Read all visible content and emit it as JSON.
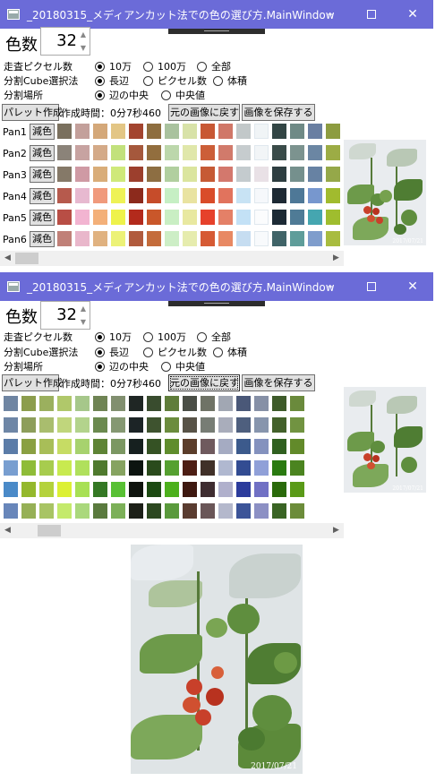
{
  "windows": [
    {
      "title": "_20180315_メディアンカット法での色の選び方.MainWindow",
      "colors_label": "色数",
      "colors_value": "32",
      "opt1": {
        "label": "走査ピクセル数",
        "choices": [
          "10万",
          "100万",
          "全部"
        ],
        "selected": 0
      },
      "opt2": {
        "label": "分割Cube選択法",
        "choices": [
          "長辺",
          "ピクセル数",
          "体積"
        ],
        "selected": 0
      },
      "opt3": {
        "label": "分割場所",
        "choices": [
          "辺の中央",
          "中央値"
        ],
        "selected": 0
      },
      "make_button": "パレット作成",
      "time_text": "作成時間：0分7秒460",
      "restore_button": "元の画像に戻す",
      "save_button": "画像を保存する",
      "reduce_label": "減色",
      "rows": [
        {
          "name": "Pan1",
          "colors": [
            "#7a705e",
            "#c3a09b",
            "#d4a879",
            "#e3c685",
            "#a3442f",
            "#8e6e3f",
            "#a9c29e",
            "#d8e2a8",
            "#c85834",
            "#d07768",
            "#c2c8c9",
            "#f0f4f6",
            "#324544",
            "#6f8a86",
            "#6a7fa2",
            "#8d9c40"
          ]
        },
        {
          "name": "Pan2",
          "colors": [
            "#8b8379",
            "#c7a3a1",
            "#d4aa88",
            "#c2e17c",
            "#a5583c",
            "#926e3e",
            "#bcd7ab",
            "#e0e7aa",
            "#cc5e38",
            "#d17a6b",
            "#c6ccce",
            "#f2f5f7",
            "#3a4b49",
            "#7c938f",
            "#6b86a3",
            "#9cac45"
          ]
        },
        {
          "name": "Pan3",
          "colors": [
            "#857968",
            "#cf9aa4",
            "#d9ad79",
            "#cfe97a",
            "#9c3f2d",
            "#8d6e42",
            "#b1cf9f",
            "#dbe59e",
            "#c65a35",
            "#d3786d",
            "#c4cbce",
            "#e9e1e6",
            "#2e3e41",
            "#75908d",
            "#6782a3",
            "#95a849"
          ]
        },
        {
          "name": "Pan4",
          "colors": [
            "#b65a4d",
            "#e7b9d0",
            "#f09a7c",
            "#eef256",
            "#8c2a1c",
            "#c64c2a",
            "#c6efc4",
            "#e9e3a1",
            "#d94c2a",
            "#e1735d",
            "#c8e3f4",
            "#f6f8fb",
            "#1e2a34",
            "#4e7897",
            "#7797ce",
            "#a1bb2e"
          ]
        },
        {
          "name": "Pan5",
          "colors": [
            "#b84e45",
            "#f2b4d1",
            "#f3b079",
            "#eef24b",
            "#b32a1c",
            "#c9572a",
            "#c9eec3",
            "#e8e8a0",
            "#e6412b",
            "#e48067",
            "#c3e1f6",
            "#fbfcfd",
            "#1c2a35",
            "#4f7b96",
            "#45a6b0",
            "#9fbd2e"
          ]
        },
        {
          "name": "Pan6",
          "colors": [
            "#c08078",
            "#e9b7cb",
            "#e0b280",
            "#ecf277",
            "#b15b3d",
            "#c46c3b",
            "#cdeec6",
            "#e6ecae",
            "#d65a34",
            "#e88963",
            "#c6ddf1",
            "#f8fafc",
            "#406468",
            "#5f9d9a",
            "#7f9dcc",
            "#a8bc3f"
          ]
        }
      ],
      "photo_date": "2017/07/21"
    },
    {
      "title": "_20180315_メディアンカット法での色の選び方.MainWindow",
      "colors_label": "色数",
      "colors_value": "32",
      "opt1": {
        "label": "走査ピクセル数",
        "choices": [
          "10万",
          "100万",
          "全部"
        ],
        "selected": 0
      },
      "opt2": {
        "label": "分割Cube選択法",
        "choices": [
          "長辺",
          "ピクセル数",
          "体積"
        ],
        "selected": 0
      },
      "opt3": {
        "label": "分割場所",
        "choices": [
          "辺の中央",
          "中央値"
        ],
        "selected": 0
      },
      "make_button": "パレット作成",
      "time_text": "作成時間：0分7秒460",
      "restore_button": "元の画像に戻す",
      "save_button": "画像を保存する",
      "rows": [
        {
          "colors": [
            "#6f85a2",
            "#8c9d4d",
            "#9bb05e",
            "#b0c86a",
            "#a6c78a",
            "#6f8454",
            "#818f6f",
            "#1f2624",
            "#394c2e",
            "#5f7d3a",
            "#4a4e46",
            "#6f7366",
            "#a1a7b3",
            "#4a5878",
            "#8690a6",
            "#3e5b2a",
            "#6a8a3c"
          ]
        },
        {
          "colors": [
            "#6e86a6",
            "#8d9e5b",
            "#a9bd6e",
            "#c0d67c",
            "#b3d38c",
            "#6b8a4f",
            "#859872",
            "#1c2426",
            "#3e532f",
            "#6b8c3d",
            "#585347",
            "#777d75",
            "#a9adbb",
            "#4e5f7e",
            "#8795ad",
            "#43612b",
            "#719341"
          ]
        },
        {
          "colors": [
            "#5b7ca8",
            "#8aa042",
            "#a8be58",
            "#c6dc64",
            "#a7d26e",
            "#5e8435",
            "#7b9762",
            "#16201f",
            "#355224",
            "#5f8d2c",
            "#5b3d2a",
            "#6f5a5e",
            "#a5abc2",
            "#3c5a8c",
            "#8492be",
            "#306020",
            "#628a2a"
          ]
        },
        {
          "colors": [
            "#789ed0",
            "#8fbc38",
            "#a7cc4e",
            "#c8ea50",
            "#b0e05c",
            "#4f7a2e",
            "#86a360",
            "#0c1410",
            "#2a4a1c",
            "#55a030",
            "#4d1e14",
            "#403028",
            "#b0b8d0",
            "#324c92",
            "#90a0d8",
            "#2a7a10",
            "#4b8420"
          ]
        },
        {
          "colors": [
            "#4a8ac8",
            "#94b82c",
            "#b4d23c",
            "#dcf034",
            "#a8e054",
            "#347824",
            "#58c034",
            "#0f140e",
            "#1c4a12",
            "#4cb01c",
            "#3e1810",
            "#3e2c30",
            "#b0b0cc",
            "#2c3c9c",
            "#7070c4",
            "#2a6a0a",
            "#5a9a18"
          ]
        },
        {
          "colors": [
            "#6886ba",
            "#96b056",
            "#a8c464",
            "#c4ea6c",
            "#aad87c",
            "#5a7a3e",
            "#7cb058",
            "#1c2018",
            "#2c4820",
            "#5a9a3c",
            "#5a3c30",
            "#6a5658",
            "#b4b8cc",
            "#3c5498",
            "#8c90c4",
            "#3a6424",
            "#6c8c3a"
          ]
        }
      ],
      "photo_date": "2017/07/21",
      "big_photo_date": "2017/07/21"
    }
  ],
  "icons": {
    "minimize": "minimize-icon",
    "maximize": "maximize-icon",
    "close": "close-icon",
    "app": "app-window-icon"
  }
}
